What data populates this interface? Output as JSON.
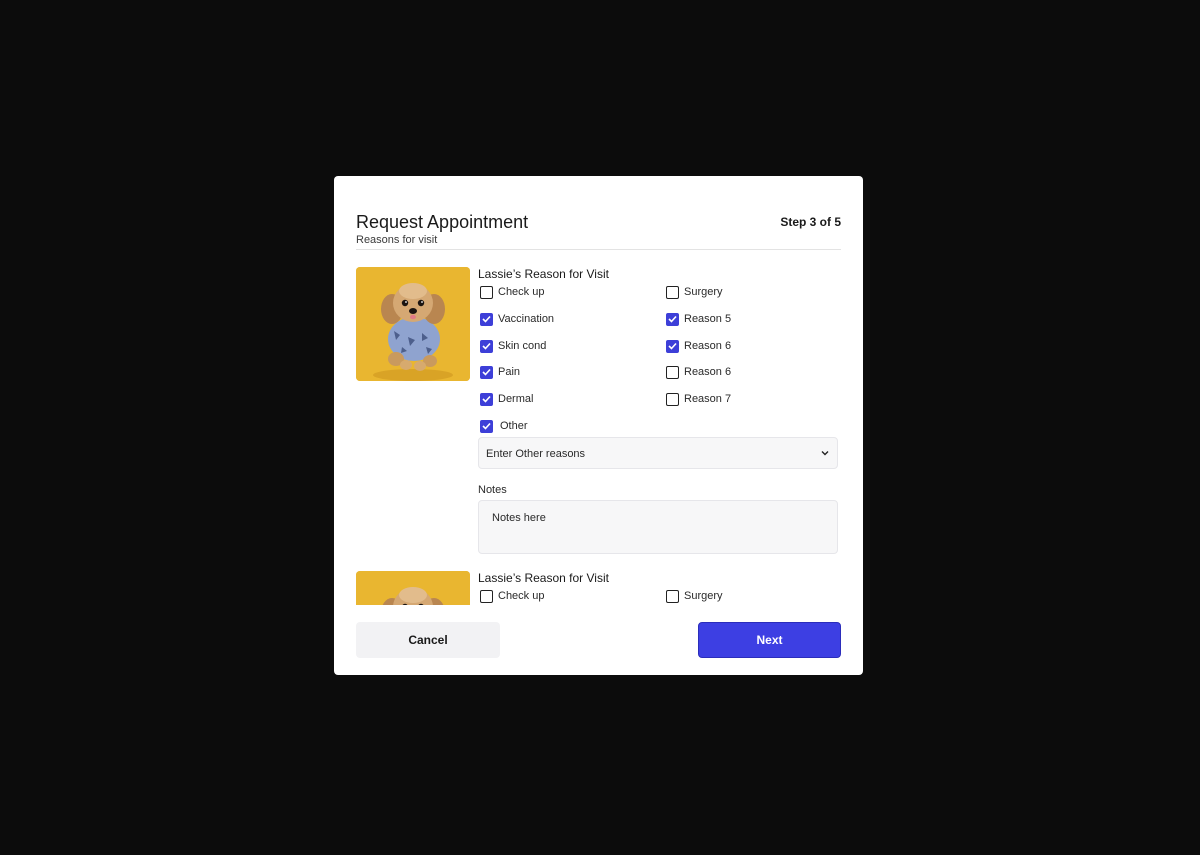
{
  "modal": {
    "title": "Request Appointment",
    "step": "Step 3 of 5",
    "subtitle": "Reasons for visit"
  },
  "pets": [
    {
      "heading": "Lassie’s Reason for Visit",
      "options_left": [
        {
          "label": "Check up",
          "checked": false
        },
        {
          "label": "Vaccination",
          "checked": true
        },
        {
          "label": "Skin cond",
          "checked": true
        },
        {
          "label": "Pain",
          "checked": true
        },
        {
          "label": "Dermal",
          "checked": true
        },
        {
          "label": "Other",
          "checked": true
        }
      ],
      "options_right": [
        {
          "label": "Surgery",
          "checked": false
        },
        {
          "label": "Reason 5",
          "checked": true
        },
        {
          "label": "Reason 6",
          "checked": true
        },
        {
          "label": "Reason 6",
          "checked": false
        },
        {
          "label": "Reason 7",
          "checked": false
        }
      ],
      "other_select": {
        "value": "Enter Other reasons"
      },
      "notes": {
        "label": "Notes",
        "placeholder": "Notes here"
      }
    },
    {
      "heading": "Lassie’s Reason for Visit",
      "options_left": [
        {
          "label": "Check up",
          "checked": false
        }
      ],
      "options_right": [
        {
          "label": "Surgery",
          "checked": false
        }
      ]
    }
  ],
  "footer": {
    "cancel_label": "Cancel",
    "next_label": "Next"
  },
  "colors": {
    "accent": "#3d3fe3",
    "checkbox_checked": "#3d3fd8",
    "backdrop": "#0c0c0c"
  },
  "icons": {
    "select_chevron": "chevron-down-icon",
    "checkbox_check": "check-icon"
  }
}
